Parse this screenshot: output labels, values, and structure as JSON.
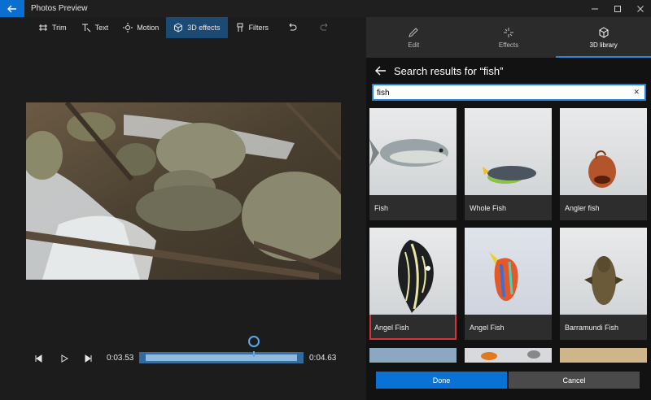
{
  "window": {
    "title": "Photos Preview",
    "controls": [
      "minimize",
      "maximize",
      "close"
    ]
  },
  "toolbar": {
    "items": [
      {
        "label": "Trim",
        "icon": "trim-icon"
      },
      {
        "label": "Text",
        "icon": "text-icon"
      },
      {
        "label": "Motion",
        "icon": "motion-icon"
      },
      {
        "label": "3D effects",
        "icon": "cube-icon",
        "active": true
      },
      {
        "label": "Filters",
        "icon": "filter-icon"
      }
    ],
    "undo_icon": "undo-icon",
    "redo_icon": "redo-icon"
  },
  "playback": {
    "current_time": "0:03.53",
    "end_time": "0:04.63"
  },
  "panel": {
    "tabs": [
      {
        "label": "Edit",
        "icon": "pencil-icon"
      },
      {
        "label": "Effects",
        "icon": "sparkle-icon"
      },
      {
        "label": "3D library",
        "icon": "cube-icon",
        "active": true
      }
    ],
    "search_title": "Search results for “fish”",
    "search_value": "fish",
    "results": [
      {
        "label": "Fish"
      },
      {
        "label": "Whole Fish"
      },
      {
        "label": "Angler fish"
      },
      {
        "label": "Angel Fish",
        "selected": true
      },
      {
        "label": "Angel Fish"
      },
      {
        "label": "Barramundi Fish"
      }
    ],
    "done_label": "Done",
    "cancel_label": "Cancel"
  },
  "colors": {
    "accent": "#0a72d4",
    "selection": "#d8323a",
    "active_tool": "#1b4a75"
  }
}
